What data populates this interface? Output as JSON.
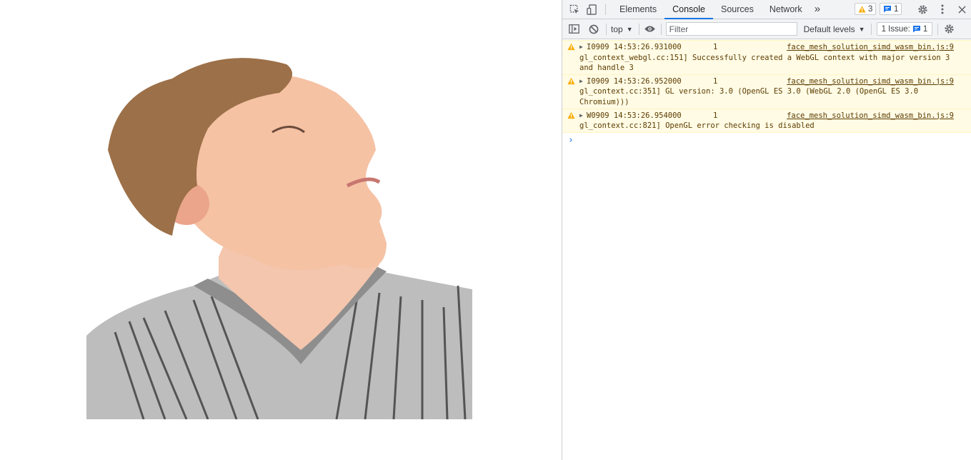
{
  "devtools": {
    "tabs": [
      {
        "label": "Elements"
      },
      {
        "label": "Console"
      },
      {
        "label": "Sources"
      },
      {
        "label": "Network"
      }
    ],
    "more_tabs_label": "»",
    "warnings_count": "3",
    "messages_count": "1"
  },
  "console_toolbar": {
    "context": "top",
    "filter_placeholder": "Filter",
    "levels": "Default levels",
    "issues_label": "1 Issue:",
    "issues_count": "1"
  },
  "messages": [
    {
      "level": "warning",
      "header": "I0909 14:53:26.931000       1",
      "source": "face_mesh_solution_simd_wasm_bin.js:9",
      "body": "gl_context_webgl.cc:151] Successfully created a WebGL context with major version 3 and handle 3"
    },
    {
      "level": "warning",
      "header": "I0909 14:53:26.952000       1",
      "source": "face_mesh_solution_simd_wasm_bin.js:9",
      "body": "gl_context.cc:351] GL version: 3.0 (OpenGL ES 3.0 (WebGL 2.0 (OpenGL ES 3.0 Chromium)))"
    },
    {
      "level": "warning",
      "header": "W0909 14:53:26.954000       1",
      "source": "face_mesh_solution_simd_wasm_bin.js:9",
      "body": "gl_context.cc:821] OpenGL error checking is disabled"
    }
  ],
  "prompt_symbol": "›",
  "colors": {
    "accent": "#1a73e8",
    "warning_bg": "#fffbe5",
    "warning_icon": "#f9ab00"
  }
}
